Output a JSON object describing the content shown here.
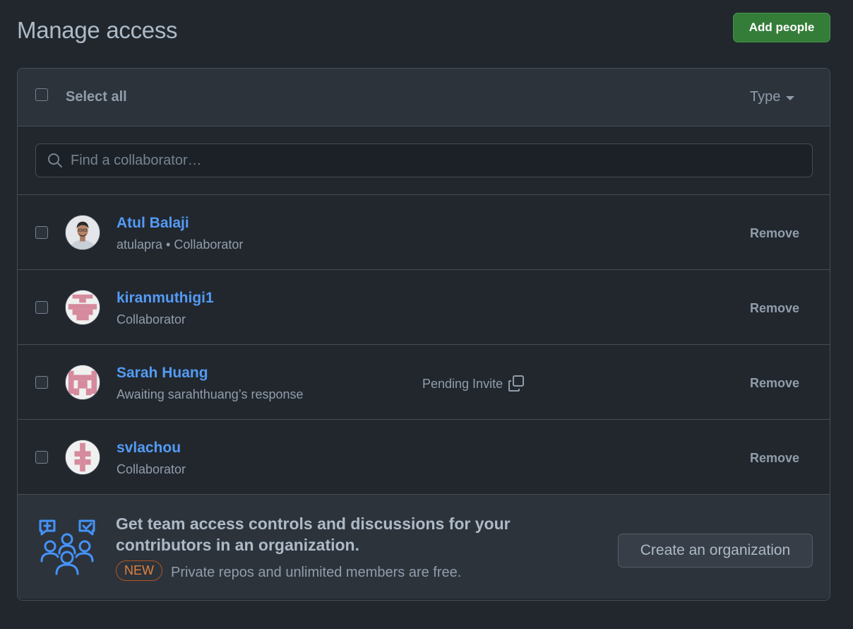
{
  "page": {
    "title": "Manage access",
    "add_button": "Add people"
  },
  "header": {
    "select_all": "Select all",
    "type_filter": "Type"
  },
  "search": {
    "placeholder": "Find a collaborator…"
  },
  "members": [
    {
      "name": "Atul Balaji",
      "sub": "atulapra • Collaborator",
      "action": "Remove",
      "avatar": "photo-avatar"
    },
    {
      "name": "kiranmuthigi1",
      "sub": "Collaborator",
      "action": "Remove",
      "avatar": "identicon-avatar"
    },
    {
      "name": "Sarah Huang",
      "sub": "Awaiting sarahthuang’s response",
      "status": "Pending Invite",
      "action": "Remove",
      "avatar": "identicon-avatar"
    },
    {
      "name": "svlachou",
      "sub": "Collaborator",
      "action": "Remove",
      "avatar": "identicon-avatar"
    }
  ],
  "promo": {
    "title": "Get team access controls and discussions for your contributors in an organization.",
    "badge": "NEW",
    "description": "Private repos and unlimited members are free.",
    "button": "Create an organization",
    "illustration": "team-people-icon"
  },
  "colors": {
    "background": "#22272e",
    "panel": "#2d333b",
    "border": "#444c56",
    "link": "#539bf5",
    "primary_button": "#347d39",
    "identicon": "#d58b9d",
    "badge": "#e0823d"
  }
}
